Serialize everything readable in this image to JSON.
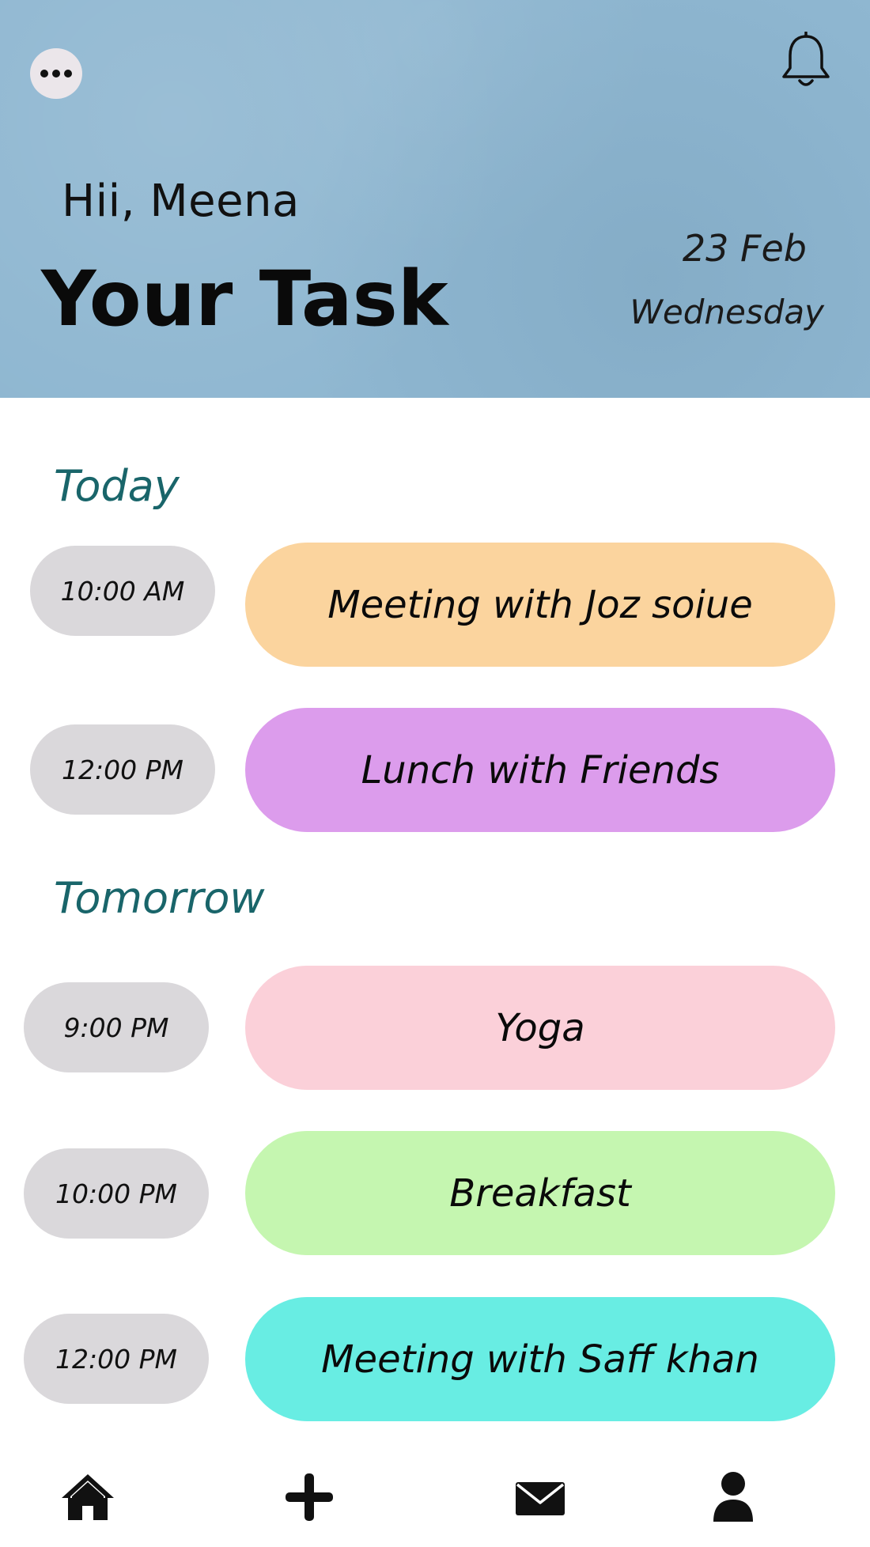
{
  "header": {
    "greeting": "Hii, Meena",
    "title": "Your Task",
    "date_day": "23 Feb",
    "date_weekday": "Wednesday",
    "menu_icon": "more-horizontal-icon",
    "notification_icon": "bell-icon"
  },
  "sections": {
    "today": {
      "title": "Today",
      "tasks": [
        {
          "time": "10:00 AM",
          "label": "Meeting with Joz soiue",
          "color": "#fbd49e"
        },
        {
          "time": "12:00 PM",
          "label": "Lunch with Friends",
          "color": "#dc9cec"
        }
      ]
    },
    "tomorrow": {
      "title": "Tomorrow",
      "tasks": [
        {
          "time": "9:00 PM",
          "label": "Yoga",
          "color": "#fbd0d9"
        },
        {
          "time": "10:00 PM",
          "label": "Breakfast",
          "color": "#c5f6b0"
        },
        {
          "time": "12:00 PM",
          "label": "Meeting with Saff khan",
          "color": "#68ede3"
        }
      ]
    }
  },
  "nav": {
    "items": [
      {
        "icon": "home-icon"
      },
      {
        "icon": "plus-icon"
      },
      {
        "icon": "mail-icon"
      },
      {
        "icon": "user-icon"
      }
    ]
  },
  "colors": {
    "header_bg": "#8fb7d1",
    "section_title": "#19656a",
    "time_pill": "#dad8db"
  }
}
